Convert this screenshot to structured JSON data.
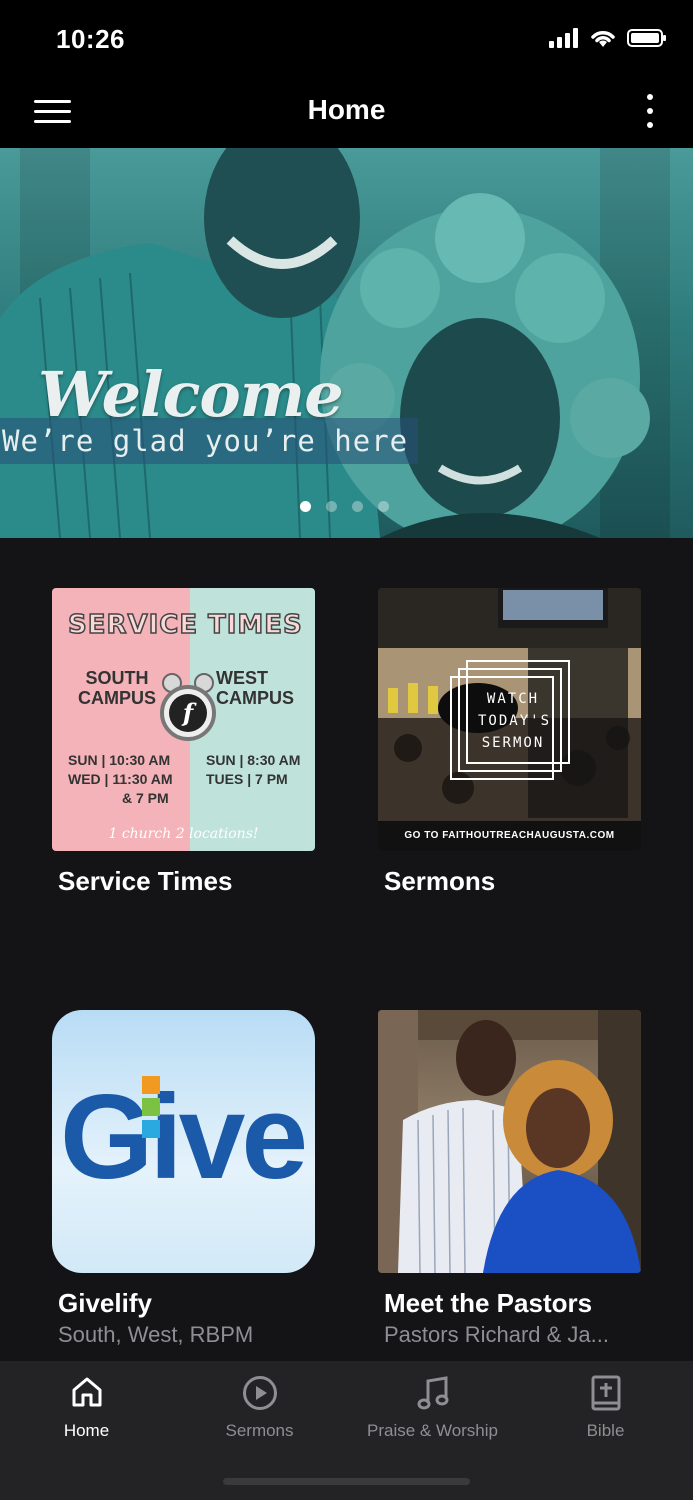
{
  "status_bar": {
    "time": "10:26"
  },
  "app_bar": {
    "title": "Home"
  },
  "hero": {
    "heading": "Welcome",
    "subheading": "We’re glad you’re here",
    "slides_total": 4,
    "active_slide": 1
  },
  "tiles": [
    {
      "title": "Service Times",
      "subtitle": "",
      "thumb": {
        "heading_left": "SERVICE",
        "heading_right": "TIMES",
        "south_line1": "SOUTH",
        "south_line2": "CAMPUS",
        "west_line1": "WEST",
        "west_line2": "CAMPUS",
        "south_sched1": "SUN | 10:30 AM",
        "south_sched2": "WED | 11:30 AM",
        "south_sched3": "& 7 PM",
        "west_sched1": "SUN | 8:30 AM",
        "west_sched2": "TUES | 7 PM",
        "footer": "1 church 2 locations!"
      }
    },
    {
      "title": "Sermons",
      "subtitle": "",
      "thumb": {
        "line1": "WATCH",
        "line2": "TODAY'S",
        "line3": "SERMON",
        "footer": "GO TO FAITHOUTREACHAUGUSTA.COM"
      }
    },
    {
      "title": "Givelify",
      "subtitle": "South, West, RBPM",
      "thumb": {
        "word": "Give"
      }
    },
    {
      "title": "Meet the Pastors",
      "subtitle": "Pastors Richard & Ja..."
    }
  ],
  "tabbar": {
    "tabs": [
      {
        "label": "Home",
        "icon": "home-icon",
        "active": true
      },
      {
        "label": "Sermons",
        "icon": "play-circle-icon",
        "active": false
      },
      {
        "label": "Praise & Worship",
        "icon": "music-note-icon",
        "active": false
      },
      {
        "label": "Bible",
        "icon": "bible-icon",
        "active": false
      }
    ]
  },
  "colors": {
    "background": "#141416",
    "bars": "#000000",
    "tabbar": "#232325",
    "inactive": "#8e8e93"
  }
}
